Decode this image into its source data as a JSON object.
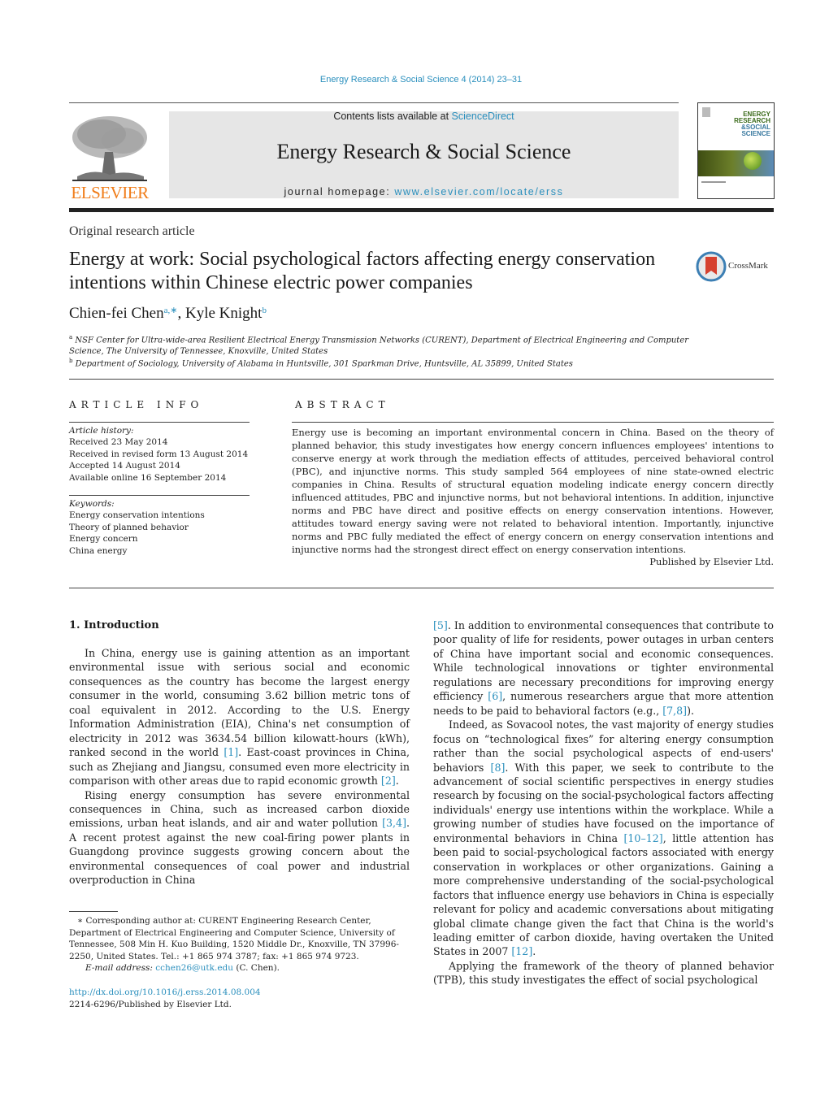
{
  "header": {
    "journal_ref": "Energy Research & Social Science 4 (2014) 23–31",
    "contents_prefix": "Contents lists available at ",
    "contents_link": "ScienceDirect",
    "journal_title": "Energy Research & Social Science",
    "homepage_prefix": "journal homepage: ",
    "homepage_link": "www.elsevier.com/locate/erss",
    "publisher_logo_text": "ELSEVIER",
    "cover_title_lines": [
      "ENERGY",
      "RESEARCH",
      "&SOCIAL",
      "SCIENCE"
    ],
    "crossmark_label": "CrossMark",
    "colors": {
      "link": "#2a8fbd",
      "elsevier_orange": "#f07d1a",
      "banner_gray": "#e6e6e6"
    }
  },
  "article": {
    "type": "Original research article",
    "title": "Energy at work: Social psychological factors affecting energy conservation intentions within Chinese electric power companies",
    "authors": [
      {
        "name": "Chien-fei Chen",
        "marks": "a,∗",
        "sep": ", "
      },
      {
        "name": "Kyle Knight",
        "marks": "b",
        "sep": ""
      }
    ],
    "affiliations": [
      {
        "mark": "a",
        "text": "NSF Center for Ultra-wide-area Resilient Electrical Energy Transmission Networks (CURENT), Department of Electrical Engineering and Computer Science, The University of Tennessee, Knoxville, United States"
      },
      {
        "mark": "b",
        "text": "Department of Sociology, University of Alabama in Huntsville, 301 Sparkman Drive, Huntsville, AL 35899, United States"
      }
    ]
  },
  "article_info": {
    "heading": "ARTICLE INFO",
    "history_label": "Article history:",
    "history": [
      "Received 23 May 2014",
      "Received in revised form 13 August 2014",
      "Accepted 14 August 2014",
      "Available online 16 September 2014"
    ],
    "keywords_label": "Keywords:",
    "keywords": [
      "Energy conservation intentions",
      "Theory of planned behavior",
      "Energy concern",
      "China energy"
    ]
  },
  "abstract": {
    "heading": "ABSTRACT",
    "text": "Energy use is becoming an important environmental concern in China. Based on the theory of planned behavior, this study investigates how energy concern influences employees' intentions to conserve energy at work through the mediation effects of attitudes, perceived behavioral control (PBC), and injunctive norms. This study sampled 564 employees of nine state-owned electric companies in China. Results of structural equation modeling indicate energy concern directly influenced attitudes, PBC and injunctive norms, but not behavioral intentions. In addition, injunctive norms and PBC have direct and positive effects on energy conservation intentions. However, attitudes toward energy saving were not related to behavioral intention. Importantly, injunctive norms and PBC fully mediated the effect of energy concern on energy conservation intentions and injunctive norms had the strongest direct effect on energy conservation intentions.",
    "published": "Published by Elsevier Ltd."
  },
  "body": {
    "section_heading": "1.  Introduction",
    "left_paragraphs": [
      [
        {
          "t": "In China, energy use is gaining attention as an important environmental issue with serious social and economic consequences as the country has become the largest energy consumer in the world, consuming 3.62 billion metric tons of coal equivalent in 2012. According to the U.S. Energy Information Administration (EIA), China's net consumption of electricity in 2012 was 3634.54 billion kilowatt-hours (kWh), ranked second in the world "
        },
        {
          "ref": "[1]"
        },
        {
          "t": ". East-coast provinces in China, such as Zhejiang and Jiangsu, consumed even more electricity in comparison with other areas due to rapid economic growth "
        },
        {
          "ref": "[2]"
        },
        {
          "t": "."
        }
      ],
      [
        {
          "t": "Rising energy consumption has severe environmental consequences in China, such as increased carbon dioxide emissions, urban heat islands, and air and water pollution "
        },
        {
          "ref": "[3,4]"
        },
        {
          "t": ". A recent protest against the new coal-firing power plants in Guangdong province suggests growing concern about the environmental consequences of coal power and industrial overproduction in China"
        }
      ]
    ],
    "right_paragraphs": [
      [
        {
          "ref": "[5]"
        },
        {
          "t": ". In addition to environmental consequences that contribute to poor quality of life for residents, power outages in urban centers of China have important social and economic consequences. While technological innovations or tighter environmental regulations are necessary preconditions for improving energy efficiency "
        },
        {
          "ref": "[6]"
        },
        {
          "t": ", numerous researchers argue that more attention needs to be paid to behavioral factors (e.g., "
        },
        {
          "ref": "[7,8]"
        },
        {
          "t": ")."
        }
      ],
      [
        {
          "t": "Indeed, as Sovacool notes, the vast majority of energy studies focus on “technological fixes” for altering energy consumption rather than the social psychological aspects of end-users' behaviors "
        },
        {
          "ref": "[8]"
        },
        {
          "t": ". With this paper, we seek to contribute to the advancement of social scientific perspectives in energy studies research by focusing on the social-psychological factors affecting individuals' energy use intentions within the workplace. While a growing number of studies have focused on the importance of environmental behaviors in China "
        },
        {
          "ref": "[10–12]"
        },
        {
          "t": ", little attention has been paid to social-psychological factors associated with energy conservation in workplaces or other organizations. Gaining a more comprehensive understanding of the social-psychological factors that influence energy use behaviors in China is especially relevant for policy and academic conversations about mitigating global climate change given the fact that China is the world's leading emitter of carbon dioxide, having overtaken the United States in 2007 "
        },
        {
          "ref": "[12]"
        },
        {
          "t": "."
        }
      ],
      [
        {
          "t": "Applying the framework of the theory of planned behavior (TPB), this study investigates the effect of social psychological"
        }
      ]
    ]
  },
  "footnote": {
    "corresponding": "∗  Corresponding author at: CURENT Engineering Research Center, Department of Electrical Engineering and Computer Science, University of Tennessee, 508 Min H. Kuo Building, 1520 Middle Dr., Knoxville, TN 37996-2250, United States. Tel.: +1 865 974 3787; fax: +1 865 974 9723.",
    "email_label": "E-mail address: ",
    "email": "cchen26@utk.edu",
    "email_suffix": " (C. Chen).",
    "doi": "http://dx.doi.org/10.1016/j.erss.2014.08.004",
    "issn": "2214-6296/Published by Elsevier Ltd."
  }
}
